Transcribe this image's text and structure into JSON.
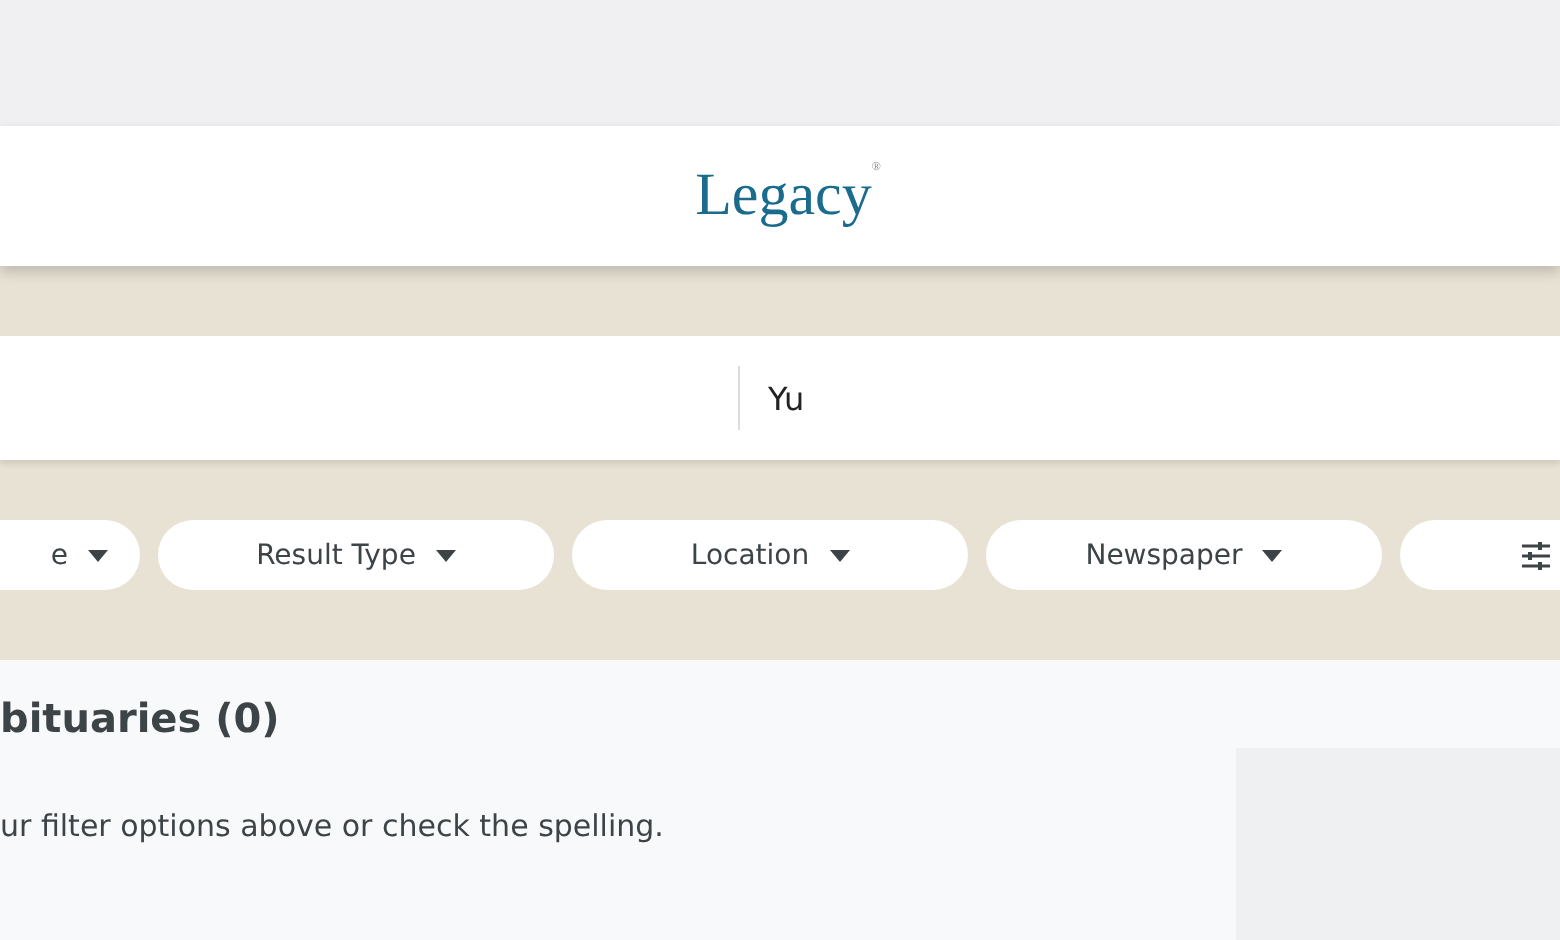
{
  "header": {
    "logo": "Legacy",
    "logo_mark": "®"
  },
  "search": {
    "last_name": "Yu"
  },
  "filters": [
    {
      "kind": "dropdown",
      "label": "e"
    },
    {
      "kind": "dropdown",
      "label": "Result Type"
    },
    {
      "kind": "dropdown",
      "label": "Location"
    },
    {
      "kind": "dropdown",
      "label": "Newspaper"
    },
    {
      "kind": "settings"
    }
  ],
  "results": {
    "heading": "bituaries (0)",
    "message": "ur filter options above or check the spelling."
  }
}
